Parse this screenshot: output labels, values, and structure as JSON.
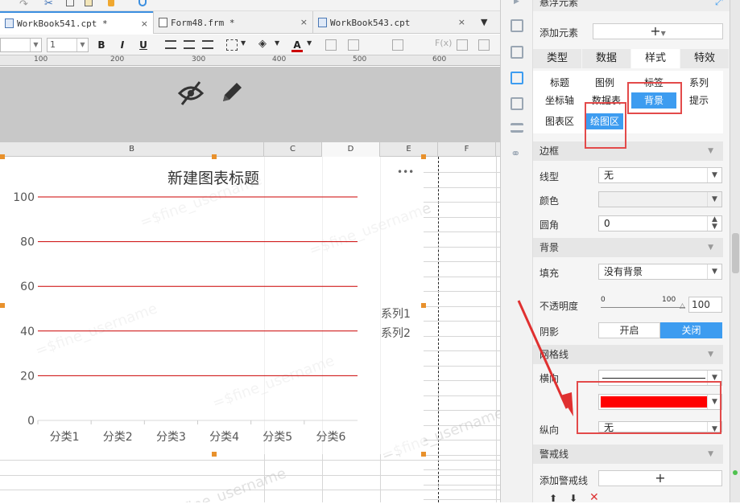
{
  "tabs": [
    {
      "label": "WorkBook541.cpt *",
      "close": "×"
    },
    {
      "label": "Form48.frm *",
      "close": "×"
    },
    {
      "label": "WorkBook543.cpt",
      "close": "×"
    }
  ],
  "format_bar": {
    "font_size": "1",
    "bold": "B",
    "italic": "I",
    "underline": "U",
    "font_color": "A"
  },
  "ruler_ticks": [
    "100",
    "200",
    "300",
    "400",
    "500",
    "600"
  ],
  "columns": [
    "B",
    "C",
    "D",
    "E",
    "F"
  ],
  "chart_data": {
    "type": "line",
    "title": "新建图表标题",
    "categories": [
      "分类1",
      "分类2",
      "分类3",
      "分类4",
      "分类5",
      "分类6"
    ],
    "y_ticks": [
      "100",
      "80",
      "60",
      "40",
      "20",
      "0"
    ],
    "ylim": [
      0,
      100
    ],
    "grid": "horizontal",
    "grid_color": "#cc0000",
    "legend_position": "right",
    "legend": [
      "系列1",
      "系列2"
    ],
    "series": [
      {
        "name": "系列1",
        "values": []
      },
      {
        "name": "系列2",
        "values": []
      }
    ]
  },
  "watermark": "=$fine_username",
  "more_label": "•••",
  "panel": {
    "header_title": "悬浮元素",
    "add_element_label": "添加元素",
    "add_element_btn": "+",
    "main_tabs": [
      "类型",
      "数据",
      "样式",
      "特效"
    ],
    "active_main_tab": "样式",
    "sub_tabs_row1": [
      "标题",
      "图例",
      "标签",
      "系列"
    ],
    "sub_tabs_row2": [
      "坐标轴",
      "数据表",
      "背景",
      "提示"
    ],
    "sub_tabs_row3": [
      "图表区",
      "绘图区"
    ],
    "border_section": "边框",
    "line_type_label": "线型",
    "line_type_value": "无",
    "color_label": "颜色",
    "radius_label": "圆角",
    "radius_value": "0",
    "bg_section": "背景",
    "fill_label": "填充",
    "fill_value": "没有背景",
    "opacity_label": "不透明度",
    "opacity_min": "0",
    "opacity_max": "100",
    "opacity_value": "100",
    "shadow_label": "阴影",
    "shadow_on": "开启",
    "shadow_off": "关闭",
    "grid_section": "网格线",
    "horizontal_label": "横向",
    "vertical_label": "纵向",
    "vertical_value": "无",
    "grid_color": "#ff0000",
    "warning_section": "警戒线",
    "add_warning_label": "添加警戒线",
    "add_warning_btn": "+"
  },
  "accent_color": "#3d9cf0",
  "highlight_color": "#e34a4a"
}
